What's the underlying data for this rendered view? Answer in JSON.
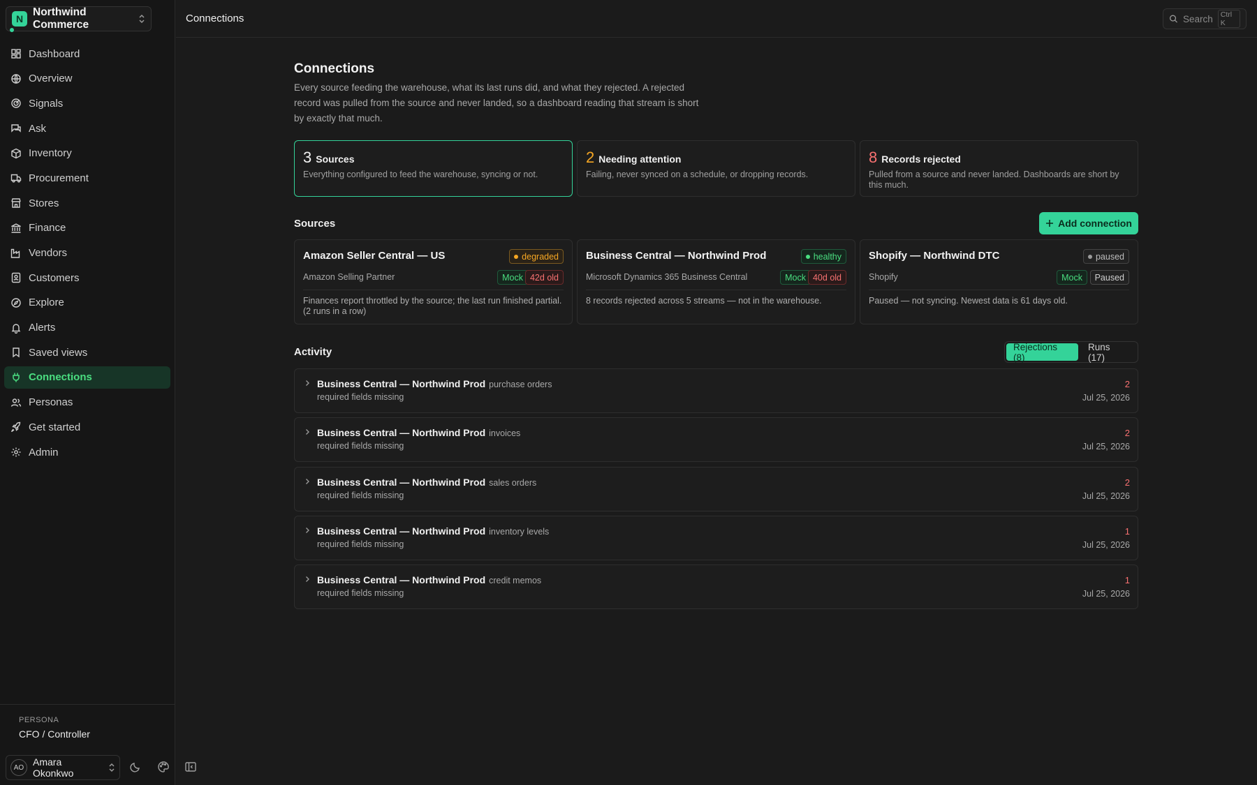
{
  "workspace": {
    "initial": "N",
    "name": "Northwind Commerce"
  },
  "nav": [
    {
      "label": "Dashboard",
      "icon": "grid-icon"
    },
    {
      "label": "Overview",
      "icon": "globe-icon"
    },
    {
      "label": "Signals",
      "icon": "radar-icon"
    },
    {
      "label": "Ask",
      "icon": "chat-icon"
    },
    {
      "label": "Inventory",
      "icon": "box-icon"
    },
    {
      "label": "Procurement",
      "icon": "truck-icon"
    },
    {
      "label": "Stores",
      "icon": "store-icon"
    },
    {
      "label": "Finance",
      "icon": "bank-icon"
    },
    {
      "label": "Vendors",
      "icon": "factory-icon"
    },
    {
      "label": "Customers",
      "icon": "id-card-icon"
    },
    {
      "label": "Explore",
      "icon": "compass-icon"
    },
    {
      "label": "Alerts",
      "icon": "bell-icon"
    },
    {
      "label": "Saved views",
      "icon": "bookmark-icon"
    },
    {
      "label": "Connections",
      "icon": "plug-icon",
      "active": true
    },
    {
      "label": "Personas",
      "icon": "users-icon"
    },
    {
      "label": "Get started",
      "icon": "rocket-icon"
    },
    {
      "label": "Admin",
      "icon": "gear-icon"
    }
  ],
  "persona": {
    "label": "PERSONA",
    "value": "CFO / Controller"
  },
  "user": {
    "initials": "AO",
    "name": "Amara Okonkwo"
  },
  "topbar": {
    "title": "Connections",
    "search_placeholder": "Search",
    "search_shortcut": "Ctrl K"
  },
  "page": {
    "title": "Connections",
    "description": "Every source feeding the warehouse, what its last runs did, and what they rejected. A rejected record was pulled from the source and never landed, so a dashboard reading that stream is short by exactly that much."
  },
  "stats": [
    {
      "num": "3",
      "label": "Sources",
      "desc": "Everything configured to feed the warehouse, syncing or not.",
      "color": "#f2f2f2"
    },
    {
      "num": "2",
      "label": "Needing attention",
      "desc": "Failing, never synced on a schedule, or dropping records.",
      "color": "#f5a623"
    },
    {
      "num": "8",
      "label": "Records rejected",
      "desc": "Pulled from a source and never landed. Dashboards are short by this much.",
      "color": "#f87171"
    }
  ],
  "sources_section": {
    "title": "Sources",
    "add_label": "Add connection"
  },
  "sources": [
    {
      "name": "Amazon Seller Central — US",
      "status": "degraded",
      "provider": "Amazon Selling Partner",
      "tag1": "Mock",
      "tag2": "42d old",
      "note": "Finances report throttled by the source; the last run finished partial. (2 runs in a row)"
    },
    {
      "name": "Business Central — Northwind Prod",
      "status": "healthy",
      "provider": "Microsoft Dynamics 365 Business Central",
      "tag1": "Mock",
      "tag2": "40d old",
      "note": "8 records rejected across 5 streams — not in the warehouse."
    },
    {
      "name": "Shopify — Northwind DTC",
      "status": "paused",
      "provider": "Shopify",
      "tag1": "Mock",
      "tag2": "Paused",
      "note": "Paused — not syncing. Newest data is 61 days old."
    }
  ],
  "activity": {
    "title": "Activity",
    "tabs": [
      "Rejections (8)",
      "Runs (17)"
    ],
    "items": [
      {
        "source": "Business Central — Northwind Prod",
        "stream": "purchase orders",
        "reason": "required fields missing",
        "count": "2",
        "date": "Jul 25, 2026"
      },
      {
        "source": "Business Central — Northwind Prod",
        "stream": "invoices",
        "reason": "required fields missing",
        "count": "2",
        "date": "Jul 25, 2026"
      },
      {
        "source": "Business Central — Northwind Prod",
        "stream": "sales orders",
        "reason": "required fields missing",
        "count": "2",
        "date": "Jul 25, 2026"
      },
      {
        "source": "Business Central — Northwind Prod",
        "stream": "inventory levels",
        "reason": "required fields missing",
        "count": "1",
        "date": "Jul 25, 2026"
      },
      {
        "source": "Business Central — Northwind Prod",
        "stream": "credit memos",
        "reason": "required fields missing",
        "count": "1",
        "date": "Jul 25, 2026"
      }
    ]
  }
}
